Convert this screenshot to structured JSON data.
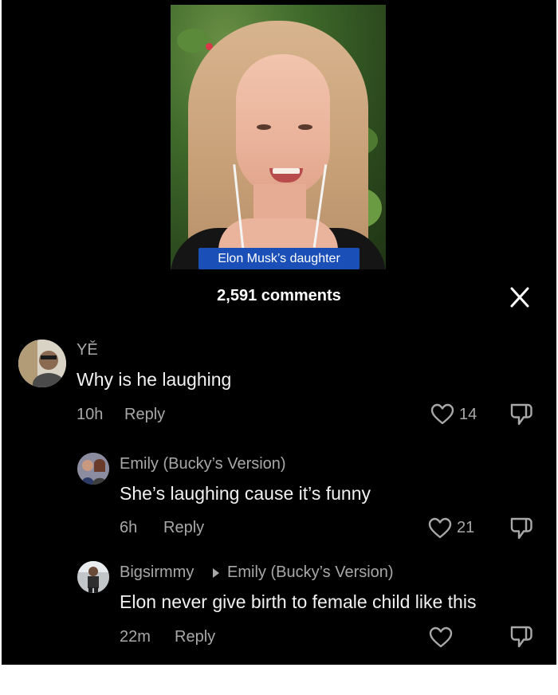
{
  "video": {
    "caption": "Elon Musk’s daughter"
  },
  "header": {
    "comments_count": "2,591 comments",
    "close_icon": "close-icon"
  },
  "comments": [
    {
      "username": "YĚ",
      "text": "Why is he laughing",
      "time": "10h",
      "reply_label": "Reply",
      "likes": "14"
    },
    {
      "username": "Emily (Bucky’s Version)",
      "text": "She’s laughing cause it’s funny",
      "time": "6h",
      "reply_label": "Reply",
      "likes": "21"
    },
    {
      "username": "Bigsirmmy",
      "reply_to": "Emily (Bucky’s Version)",
      "text": "Elon never give birth to female child like this",
      "time": "22m",
      "reply_label": "Reply",
      "likes": ""
    }
  ],
  "colors": {
    "background": "#000000",
    "caption_bg": "#1a4fb8",
    "secondary_text": "#a8a8a8"
  }
}
